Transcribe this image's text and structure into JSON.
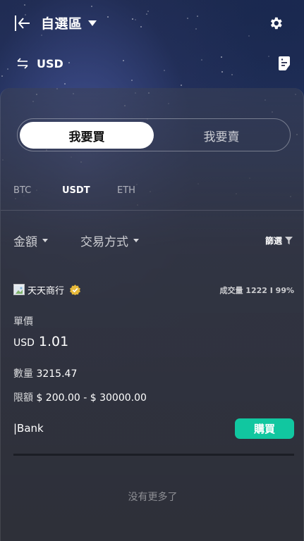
{
  "header": {
    "title": "自選區",
    "currency": "USD",
    "icons": [
      "back-icon",
      "gear-icon",
      "swap-icon",
      "doc-icon"
    ]
  },
  "trade_toggle": {
    "buy_label": "我要買",
    "sell_label": "我要賣",
    "selected": "buy"
  },
  "coins": [
    {
      "label": "BTC",
      "active": false
    },
    {
      "label": "USDT",
      "active": true
    },
    {
      "label": "ETH",
      "active": false
    }
  ],
  "filters": {
    "amount_label": "金額",
    "payment_label": "交易方式",
    "screen_label": "篩選"
  },
  "listing": {
    "merchant_name": "天天商行",
    "stats": "成交量 1222 I 99%",
    "price_label": "單價",
    "price_currency": "USD",
    "price_value": "1.01",
    "quantity_label": "數量",
    "quantity_value": "3215.47",
    "limit_label": "限額",
    "limit_value": "$ 200.00 - $ 30000.00",
    "payment_method": "|Bank",
    "buy_button": "購買"
  },
  "footer": {
    "no_more": "没有更多了"
  },
  "colors": {
    "accent": "#11c7a0",
    "panel": "#2e3039"
  }
}
